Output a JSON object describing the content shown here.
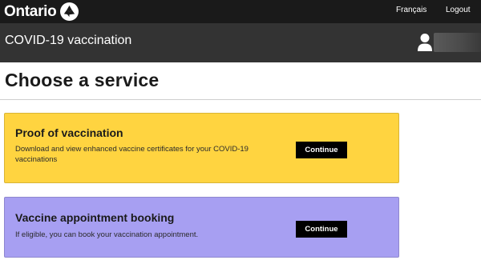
{
  "header": {
    "brand": "Ontario",
    "links": {
      "language": "Français",
      "logout": "Logout"
    }
  },
  "appbar": {
    "title": "COVID-19 vaccination"
  },
  "page": {
    "title": "Choose a service"
  },
  "services": [
    {
      "title": "Proof of vaccination",
      "description": "Download and view enhanced vaccine certificates for your COVID-19 vaccinations",
      "button": "Continue",
      "color": "#ffd440"
    },
    {
      "title": "Vaccine appointment booking",
      "description": "If eligible, you can book your vaccination appointment.",
      "button": "Continue",
      "color": "#a79ff2"
    }
  ],
  "icons": {
    "logo": "ontario-trillium-icon",
    "user": "user-icon"
  }
}
